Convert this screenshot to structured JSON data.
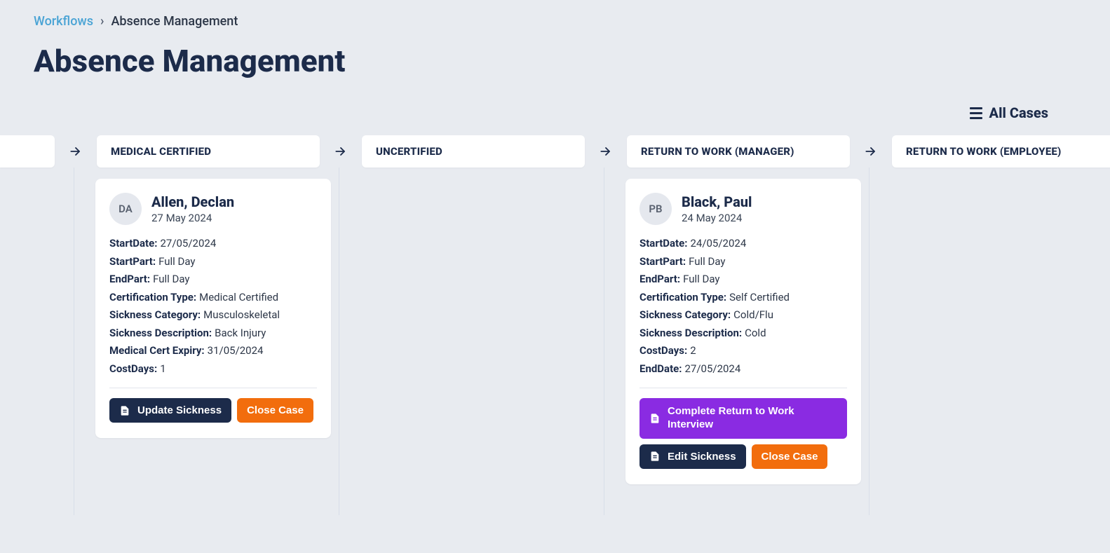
{
  "breadcrumb": {
    "root": "Workflows",
    "current": "Absence Management"
  },
  "page_title": "Absence Management",
  "toolbar": {
    "all_cases_label": "All Cases"
  },
  "columns": {
    "medical_certified": "MEDICAL CERTIFIED",
    "uncertified": "UNCERTIFIED",
    "rtw_manager": "RETURN TO WORK (MANAGER)",
    "rtw_employee": "RETURN TO WORK (EMPLOYEE)"
  },
  "labels": {
    "start_date": "StartDate:",
    "start_part": "StartPart:",
    "end_part": "EndPart:",
    "cert_type": "Certification Type:",
    "sick_cat": "Sickness Category:",
    "sick_desc": "Sickness Description:",
    "med_exp": "Medical Cert Expiry:",
    "cost_days": "CostDays:",
    "end_date": "EndDate:"
  },
  "cards": {
    "allen": {
      "initials": "DA",
      "name": "Allen, Declan",
      "date": "27 May 2024",
      "start_date": "27/05/2024",
      "start_part": "Full Day",
      "end_part": "Full Day",
      "cert_type": "Medical Certified",
      "sick_cat": "Musculoskeletal",
      "sick_desc": "Back Injury",
      "med_exp": "31/05/2024",
      "cost_days": "1",
      "actions": {
        "update": "Update Sickness",
        "close": "Close Case"
      }
    },
    "black": {
      "initials": "PB",
      "name": "Black, Paul",
      "date": "24 May 2024",
      "start_date": "24/05/2024",
      "start_part": "Full Day",
      "end_part": "Full Day",
      "cert_type": "Self Certified",
      "sick_cat": "Cold/Flu",
      "sick_desc": "Cold",
      "cost_days": "2",
      "end_date": "27/05/2024",
      "actions": {
        "complete": "Complete Return to Work Interview",
        "edit": "Edit Sickness",
        "close": "Close Case"
      }
    }
  }
}
